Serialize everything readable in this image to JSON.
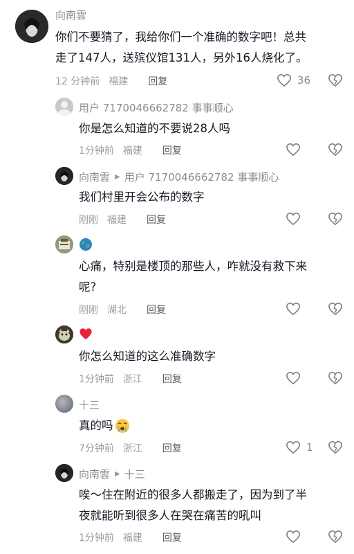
{
  "comments": [
    {
      "username": "向南雲",
      "lines": [
        "你们不要猜了，我给你们一个准确的数字吧！总共",
        "走了147人，送殡仪馆131人，另外16人烧化了。"
      ],
      "time": "12 分钟前",
      "location": "福建",
      "reply_label": "回复",
      "likes": "36"
    },
    {
      "username": "用户 7170046662782 事事顺心",
      "lines": [
        "你是怎么知道的不要说28人吗"
      ],
      "time": "1分钟前",
      "location": "福建",
      "reply_label": "回复",
      "likes": ""
    },
    {
      "username": "向南雲",
      "reply_to": "用户 7170046662782 事事顺心",
      "lines": [
        "我们村里开会公布的数字"
      ],
      "time": "刚刚",
      "location": "福建",
      "reply_label": "回复",
      "likes": ""
    },
    {
      "username": "",
      "lines": [
        "心痛，特别是楼顶的那些人，咋就没有救下来",
        "呢?"
      ],
      "time": "刚刚",
      "location": "湖北",
      "reply_label": "回复",
      "likes": ""
    },
    {
      "username": "",
      "lines": [
        "你怎么知道的这么准确数字"
      ],
      "time": "1分钟前",
      "location": "浙江",
      "reply_label": "回复",
      "likes": ""
    },
    {
      "username": "十三",
      "lines": [
        "真的吗"
      ],
      "time": "7分钟前",
      "location": "浙江",
      "reply_label": "回复",
      "likes": "1"
    },
    {
      "username": "向南雲",
      "reply_to": "十三",
      "lines": [
        "唉～住在附近的很多人都搬走了，因为到了半",
        "夜就能听到很多人在哭在痛苦的吼叫"
      ],
      "time": "1分钟前",
      "location": "福建",
      "reply_label": "回复",
      "likes": ""
    }
  ],
  "icons": {
    "like": "heart-outline-icon",
    "dislike": "broken-heart-icon",
    "reply_arrow": "triangle-right-icon",
    "emojis": [
      "globe-icon",
      "red-heart-icon",
      "crying-face-icon"
    ]
  },
  "colors": {
    "text": "#161823",
    "meta": "#9a9ba1",
    "name": "#8a8b91",
    "reply": "#5d5e66",
    "red_heart": "#e8243a"
  }
}
